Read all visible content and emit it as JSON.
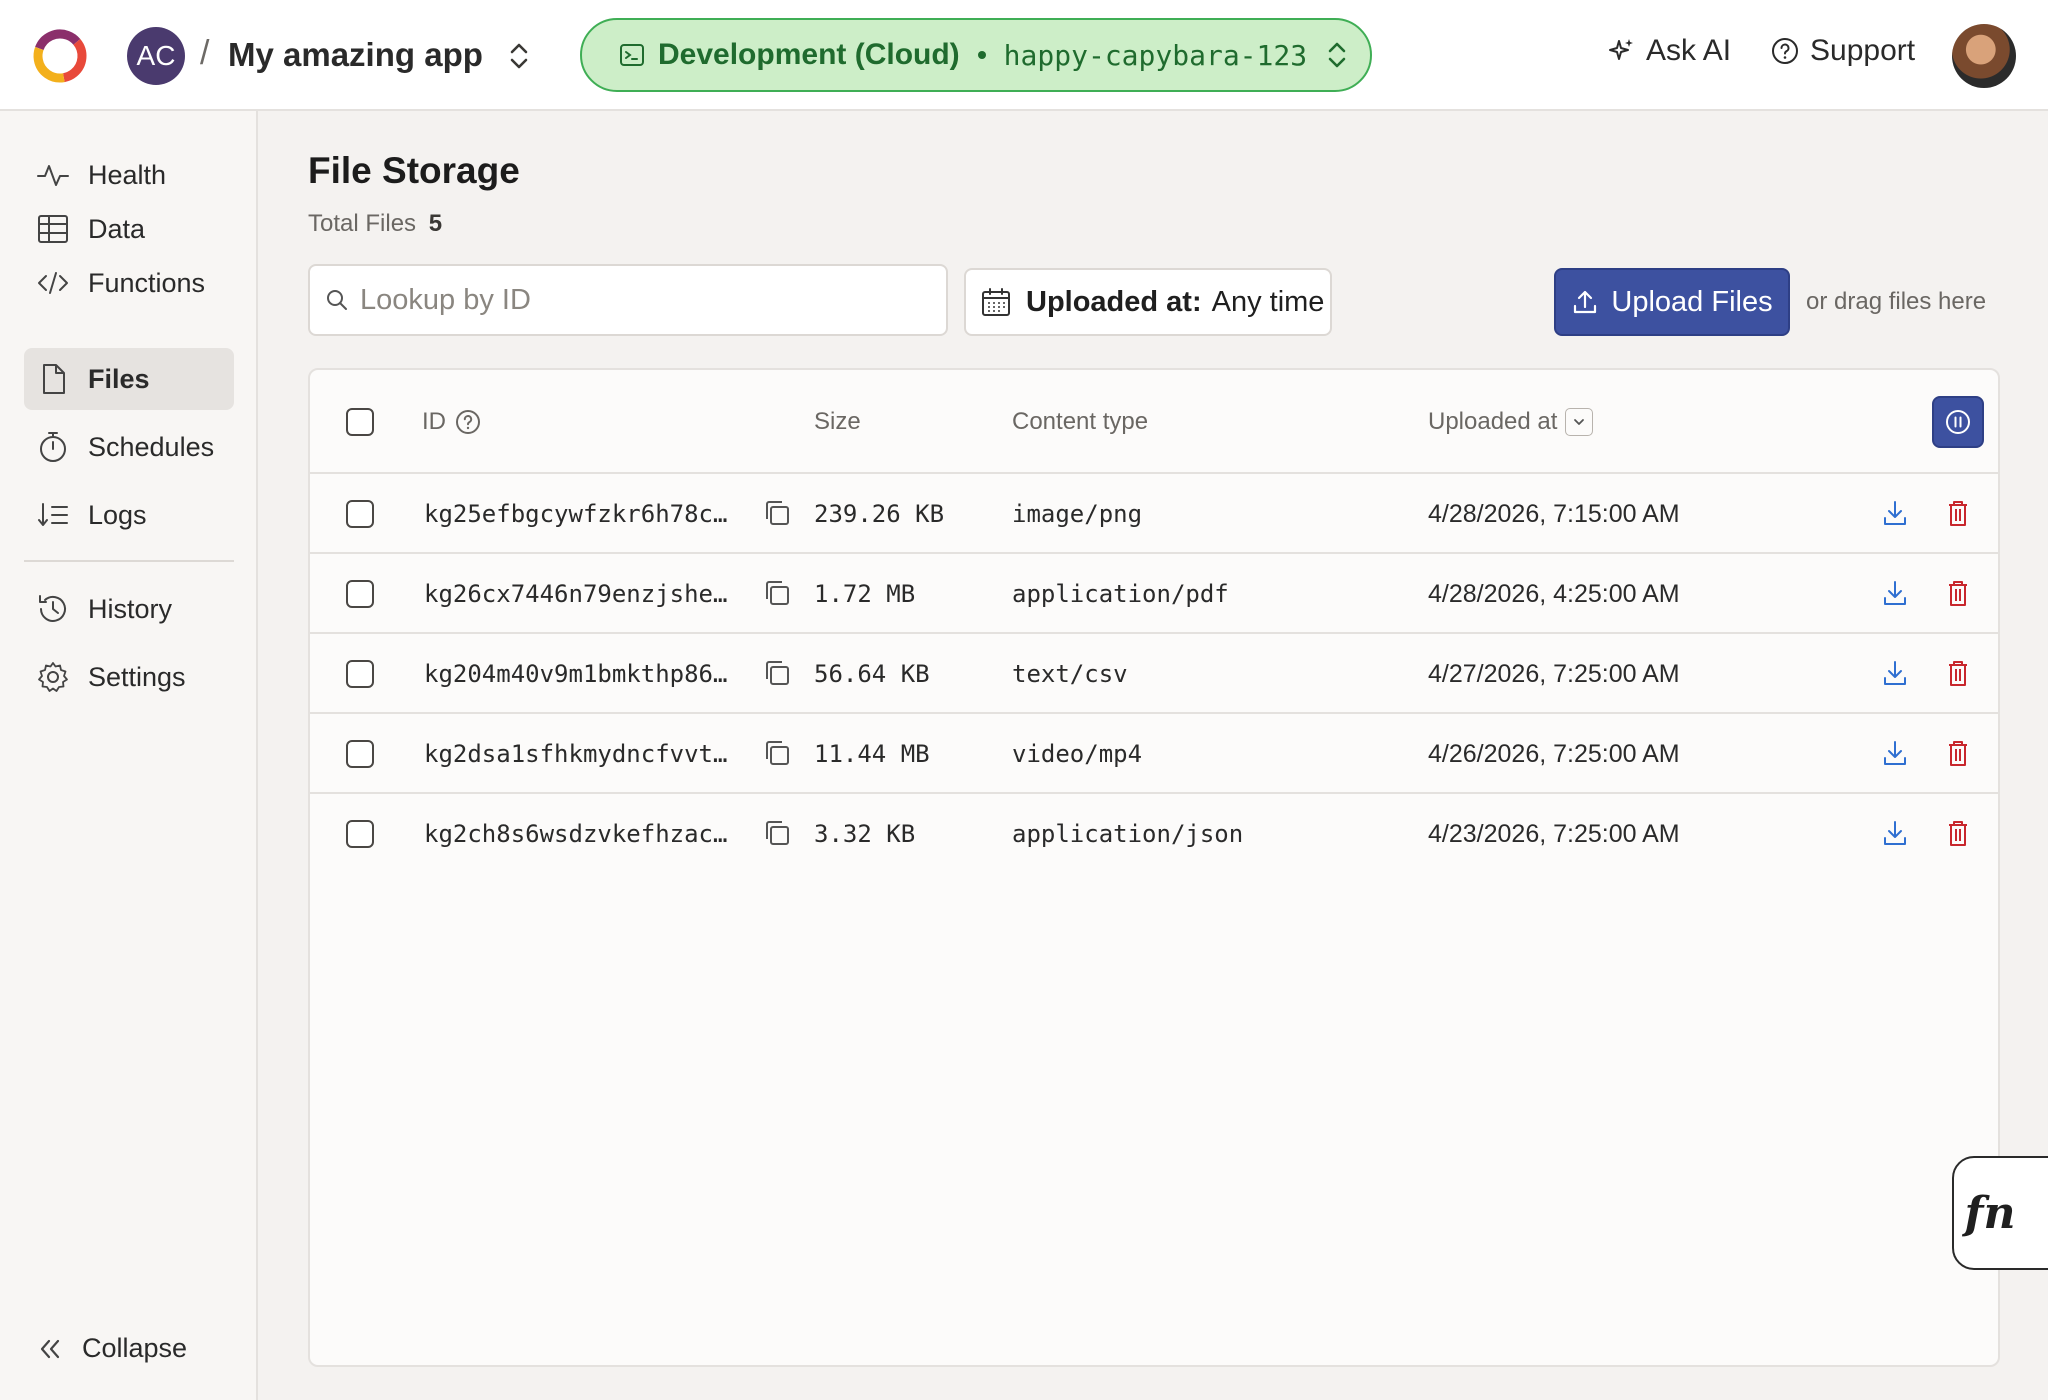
{
  "header": {
    "team_initials": "AC",
    "breadcrumb_separator": "/",
    "project_name": "My amazing app",
    "environment_label": "Development (Cloud)",
    "deployment_name": "happy-capybara-123",
    "ask_ai_label": "Ask AI",
    "support_label": "Support"
  },
  "sidebar": {
    "items": [
      {
        "label": "Health",
        "icon": "pulse-icon"
      },
      {
        "label": "Data",
        "icon": "table-icon"
      },
      {
        "label": "Functions",
        "icon": "code-icon"
      },
      {
        "label": "Files",
        "icon": "file-icon",
        "active": true
      },
      {
        "label": "Schedules",
        "icon": "stopwatch-icon"
      },
      {
        "label": "Logs",
        "icon": "logs-icon"
      },
      {
        "label": "History",
        "icon": "history-icon"
      },
      {
        "label": "Settings",
        "icon": "gear-icon"
      }
    ],
    "collapse_label": "Collapse"
  },
  "main": {
    "title": "File Storage",
    "total_files_label": "Total Files",
    "total_files_count": "5",
    "search_placeholder": "Lookup by ID",
    "date_filter_label": "Uploaded at:",
    "date_filter_value": "Any time",
    "upload_label": "Upload Files",
    "drag_hint": "or drag files here"
  },
  "table": {
    "columns": {
      "id": "ID",
      "size": "Size",
      "content_type": "Content type",
      "uploaded_at": "Uploaded at"
    },
    "rows": [
      {
        "id": "kg25efbgcywfzkr6h78c…",
        "size": "239.26 KB",
        "content_type": "image/png",
        "uploaded_at": "4/28/2026, 7:15:00 AM"
      },
      {
        "id": "kg26cx7446n79enzjshe…",
        "size": "1.72 MB",
        "content_type": "application/pdf",
        "uploaded_at": "4/28/2026, 4:25:00 AM"
      },
      {
        "id": "kg204m40v9m1bmkthp86…",
        "size": "56.64 KB",
        "content_type": "text/csv",
        "uploaded_at": "4/27/2026, 7:25:00 AM"
      },
      {
        "id": "kg2dsa1sfhkmydncfvvt…",
        "size": "11.44 MB",
        "content_type": "video/mp4",
        "uploaded_at": "4/26/2026, 7:25:00 AM"
      },
      {
        "id": "kg2ch8s6wsdzvkefhzac…",
        "size": "3.32 KB",
        "content_type": "application/json",
        "uploaded_at": "4/23/2026, 7:25:00 AM"
      }
    ]
  },
  "function_runner_label": "fn",
  "colors": {
    "accent": "#3d51a0",
    "env_green": "#1f6b2e",
    "env_bg": "#cdeec8",
    "download_blue": "#2f6fd1",
    "delete_red": "#c8262c"
  }
}
